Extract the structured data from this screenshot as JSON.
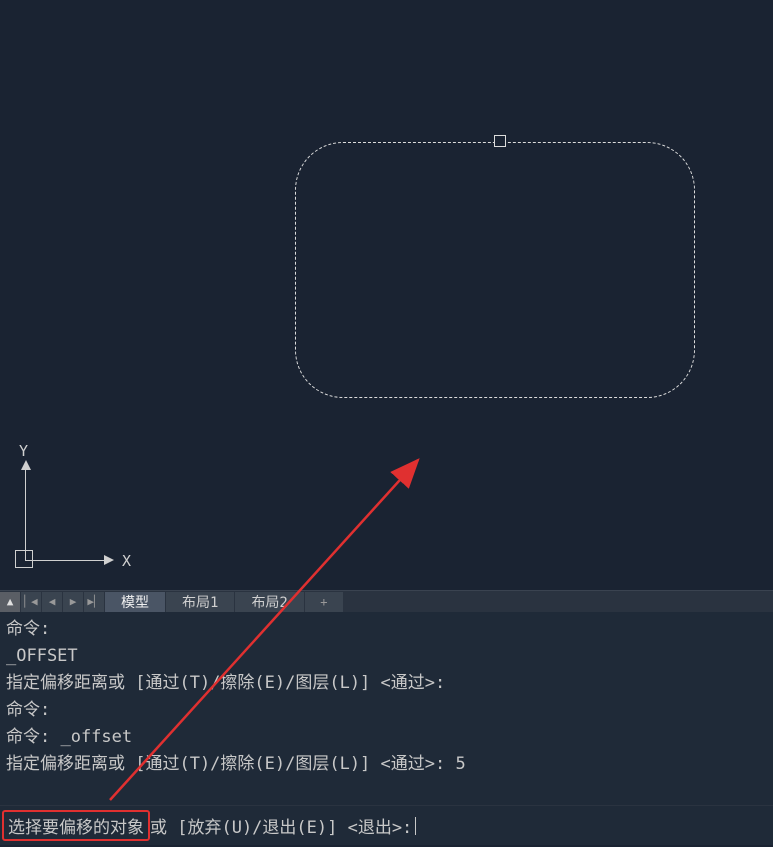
{
  "ucs": {
    "x_label": "X",
    "y_label": "Y"
  },
  "tabs": {
    "nav_up": "▲",
    "nav_first": "▏◀",
    "nav_prev": "◀",
    "nav_next": "▶",
    "nav_last": "▶▏",
    "model": "模型",
    "layout1": "布局1",
    "layout2": "布局2",
    "add": "+"
  },
  "history": {
    "line1": "命令:",
    "line2": "_OFFSET",
    "line3": "指定偏移距离或 [通过(T)/擦除(E)/图层(L)] <通过>:",
    "line4": "命令:",
    "line5": "命令: _offset",
    "line6": "指定偏移距离或 [通过(T)/擦除(E)/图层(L)] <通过>: 5"
  },
  "prompt": {
    "highlighted": "选择要偏移的对象",
    "rest": "或 [放弃(U)/退出(E)] <退出>: "
  }
}
